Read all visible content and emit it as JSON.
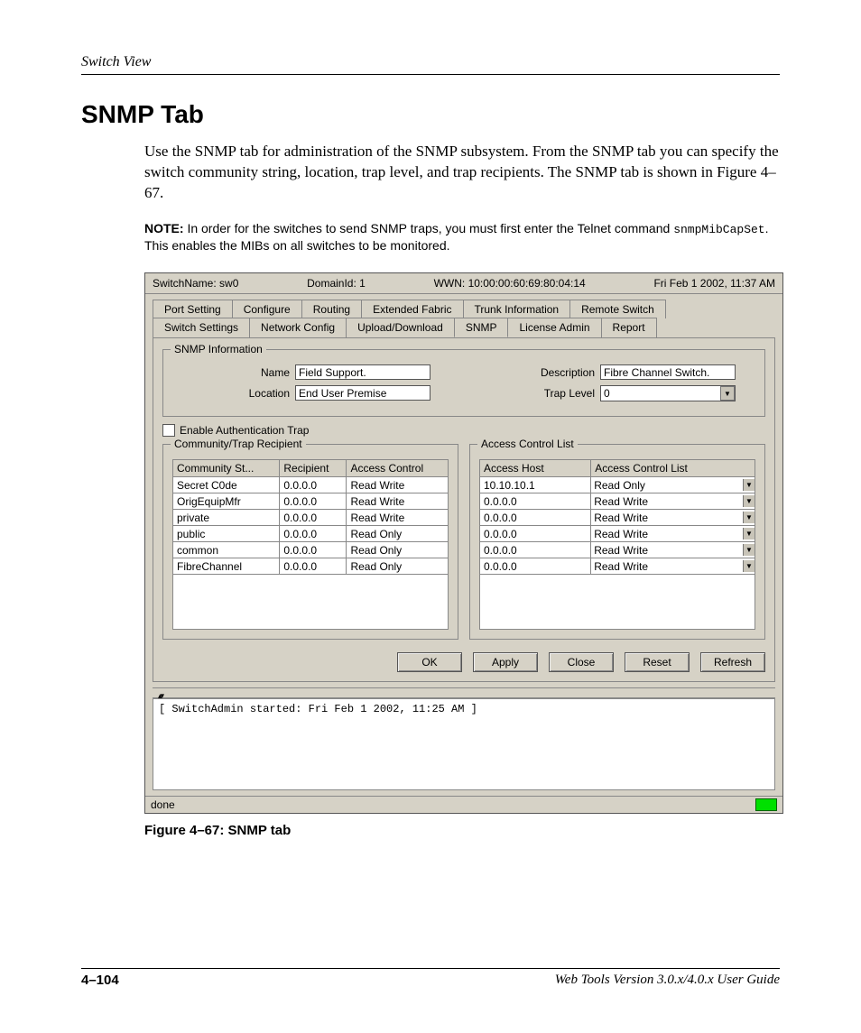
{
  "header_section": "Switch View",
  "title": "SNMP Tab",
  "paragraph": "Use the SNMP tab for administration of the SNMP subsystem. From the SNMP tab you can specify the switch community string, location, trap level, and trap recipients. The SNMP tab is shown in Figure 4–67.",
  "note_label": "NOTE:",
  "note_text_1": "In order for the switches to send SNMP traps, you must first enter the Telnet command ",
  "note_code": "snmpMibCapSet",
  "note_text_2": ". This enables the MIBs on all switches to be monitored.",
  "figure_caption": "Figure 4–67:  SNMP tab",
  "footer_page": "4–104",
  "footer_doc": "Web Tools Version 3.0.x/4.0.x User Guide",
  "infobar": {
    "switch": "SwitchName: sw0",
    "domain": "DomainId: 1",
    "wwn": "WWN: 10:00:00:60:69:80:04:14",
    "time": "Fri Feb 1  2002, 11:37 AM"
  },
  "tabs_row1": [
    "Port Setting",
    "Configure",
    "Routing",
    "Extended Fabric",
    "Trunk Information",
    "Remote Switch"
  ],
  "tabs_row2": [
    "Switch Settings",
    "Network Config",
    "Upload/Download",
    "SNMP",
    "License Admin",
    "Report"
  ],
  "active_tab": "SNMP",
  "group_snmp_info": "SNMP Information",
  "labels": {
    "name": "Name",
    "description": "Description",
    "location": "Location",
    "trap_level": "Trap Level"
  },
  "fields": {
    "name": "Field Support.",
    "description": "Fibre Channel Switch.",
    "location": "End User Premise",
    "trap_level": "0"
  },
  "checkbox_label": "Enable Authentication Trap",
  "group_ctr": "Community/Trap Recipient",
  "ctr_headers": [
    "Community St...",
    "Recipient",
    "Access Control"
  ],
  "ctr_rows": [
    {
      "c": "Secret C0de",
      "r": "0.0.0.0",
      "a": "Read Write"
    },
    {
      "c": "OrigEquipMfr",
      "r": "0.0.0.0",
      "a": "Read Write"
    },
    {
      "c": "private",
      "r": "0.0.0.0",
      "a": "Read Write"
    },
    {
      "c": "public",
      "r": "0.0.0.0",
      "a": "Read Only"
    },
    {
      "c": "common",
      "r": "0.0.0.0",
      "a": "Read Only"
    },
    {
      "c": "FibreChannel",
      "r": "0.0.0.0",
      "a": "Read Only"
    }
  ],
  "group_acl": "Access Control List",
  "acl_headers": [
    "Access Host",
    "Access Control List"
  ],
  "acl_rows": [
    {
      "h": "10.10.10.1",
      "a": "Read Only"
    },
    {
      "h": "0.0.0.0",
      "a": "Read Write"
    },
    {
      "h": "0.0.0.0",
      "a": "Read Write"
    },
    {
      "h": "0.0.0.0",
      "a": "Read Write"
    },
    {
      "h": "0.0.0.0",
      "a": "Read Write"
    },
    {
      "h": "0.0.0.0",
      "a": "Read Write"
    }
  ],
  "buttons": [
    "OK",
    "Apply",
    "Close",
    "Reset",
    "Refresh"
  ],
  "log_text": "[ SwitchAdmin started: Fri Feb 1  2002, 11:25 AM ]",
  "status_text": "done"
}
